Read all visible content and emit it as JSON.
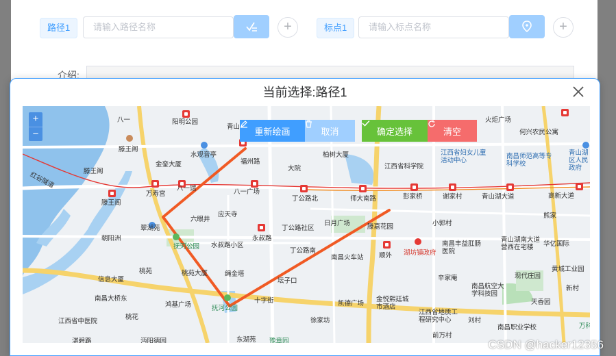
{
  "form": {
    "route_tag": "路径1",
    "route_placeholder": "请输入路径名称",
    "marker_tag": "标点1",
    "marker_placeholder": "请输入标点名称",
    "intro_label": "介绍:"
  },
  "dialog": {
    "title": "当前选择:路径1",
    "close_icon": "close-icon"
  },
  "map": {
    "zoom_in": "+",
    "zoom_out": "−",
    "buttons": {
      "redraw": "重新绘画",
      "cancel": "取消",
      "confirm": "确定选择",
      "clear": "清空"
    },
    "labels": {
      "l1": "八一",
      "l2": "阳明公园",
      "l3": "青山",
      "l4": "火炬广场",
      "l5": "何兴农民公寓",
      "l6": "滕王阁",
      "l7": "水观音亭",
      "l8": "金銮大厦",
      "l9": "福州路",
      "l10": "柏树大厦",
      "l11": "江西省科学院",
      "l12": "江西省妇女儿童活动中心",
      "l13": "南昌师范高等专科学校",
      "l14": "青山湖区人民政府",
      "l15": "大院",
      "l16": "红谷隧道",
      "l17": "八一馆",
      "l18": "八一广场",
      "l19": "丁公路北",
      "l20": "师大南路",
      "l21": "彭家桥",
      "l22": "谢家村",
      "l23": "青山湖大道",
      "l24": "高新大道",
      "l25": "滕王阁",
      "l26": "万寿宫",
      "l27": "应天寺",
      "l28": "六眼井",
      "l29": "丁公路社区",
      "l30": "日月广场",
      "l31": "滕嘉花园",
      "l32": "小郭村",
      "l33": "熊家",
      "l34": "翠湖苑",
      "l35": "朝阳洲",
      "l36": "抚河公园",
      "l37": "水叔路小区",
      "l38": "永叔路",
      "l39": "丁公路南",
      "l40": "南昌火车站",
      "l41": "顺外",
      "l42": "湖坊镇政府",
      "l43": "南昌丰益肛肠医院",
      "l44": "青山湖南大道营西在宅楼",
      "l45": "华亿国际",
      "l46": "桃苑",
      "l47": "桃苑大厦",
      "l48": "绳金塔",
      "l49": "坛子口",
      "l50": "辛家庵",
      "l51": "现代庄园",
      "l52": "黄城工业园",
      "l53": "信息大厦",
      "l54": "南昌大桥东",
      "l55": "鸿基广场",
      "l56": "抚河公园",
      "l57": "十字街",
      "l58": "凯德广场",
      "l59": "金悦熙廷城市酒店",
      "l60": "南昌航空大学科技园",
      "l61": "天香园",
      "l62": "新村",
      "l63": "江西省中医院",
      "l64": "桃花",
      "l65": "徐家坊",
      "l66": "江西省地质工程研究中心",
      "l67": "刘村",
      "l68": "南昌职业学校",
      "l69": "湛碧路",
      "l70": "沔阳德园",
      "l71": "东湖苑",
      "l72": "豫章园",
      "l73": "前万村",
      "l74": "万科"
    }
  },
  "watermark": "CSDN @hacker12356",
  "colors": {
    "primary": "#409eff",
    "success": "#67c23a",
    "danger": "#f56c6c",
    "route": "#f05a24"
  }
}
